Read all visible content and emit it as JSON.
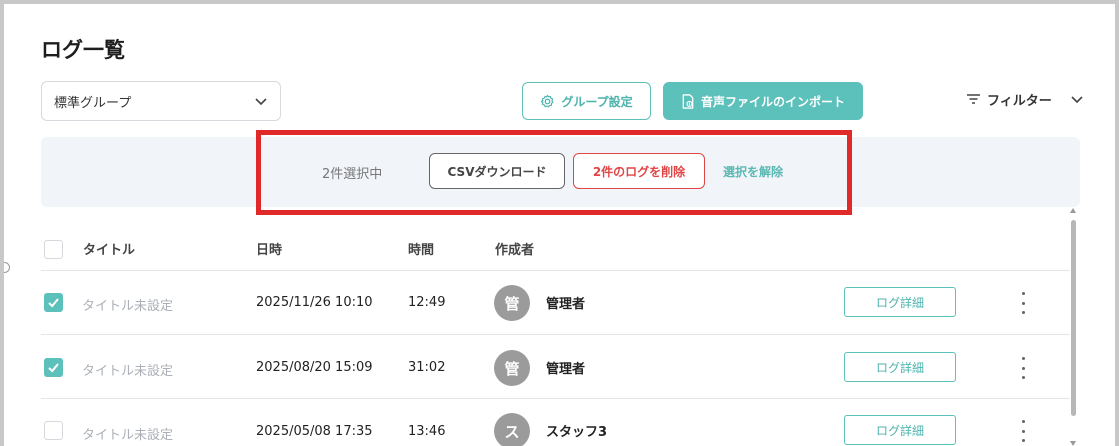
{
  "page": {
    "title": "ログ一覧"
  },
  "group_select": {
    "value": "標準グループ"
  },
  "toolbar": {
    "group_settings_label": "グループ設定",
    "import_label": "音声ファイルのインポート",
    "filter_label": "フィルター"
  },
  "selection": {
    "count_label": "2件選択中",
    "csv_label": "CSVダウンロード",
    "delete_label": "2件のログを削除",
    "clear_label": "選択を解除"
  },
  "table": {
    "headers": {
      "title": "タイトル",
      "date": "日時",
      "time": "時間",
      "author": "作成者"
    },
    "rows": [
      {
        "checked": true,
        "title": "タイトル未設定",
        "date": "2025/11/26 10:10",
        "time": "12:49",
        "avatar": "管",
        "author": "管理者",
        "detail_label": "ログ詳細"
      },
      {
        "checked": true,
        "title": "タイトル未設定",
        "date": "2025/08/20 15:09",
        "time": "31:02",
        "avatar": "管",
        "author": "管理者",
        "detail_label": "ログ詳細"
      },
      {
        "checked": false,
        "title": "タイトル未設定",
        "date": "2025/05/08 17:35",
        "time": "13:46",
        "avatar": "ス",
        "author": "スタッフ3",
        "detail_label": "ログ詳細"
      }
    ]
  },
  "colors": {
    "accent": "#5cc0bb",
    "danger": "#e04646",
    "highlight_box": "#e02a2a"
  },
  "icons": {
    "group_settings": "gear-icon",
    "import": "file-upload-icon",
    "filter": "filter-lines-icon",
    "select_dropdown": "chevron-down-icon",
    "row_menu": "kebab-menu-icon"
  }
}
